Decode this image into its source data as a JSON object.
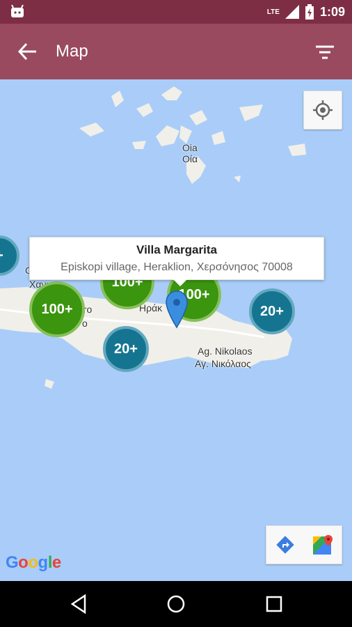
{
  "status": {
    "network": "LTE",
    "time": "1:09"
  },
  "appbar": {
    "title": "Map"
  },
  "map": {
    "labels": {
      "oia1": "Oia",
      "oia2": "Οία",
      "heraklion": "Ηράκ",
      "ag_nikolaos_latin": "Ag. Nikolaos",
      "ag_nikolaos_greek": "Αγ. Νικόλαος",
      "hania": "Χανι",
      "o_label": "Ο",
      "ero": "ero",
      "o2": "o"
    },
    "clusters": [
      {
        "label": "+",
        "color": "teal"
      },
      {
        "label": "100+",
        "color": "green"
      },
      {
        "label": "100+",
        "color": "green"
      },
      {
        "label": "100+",
        "color": "green"
      },
      {
        "label": "20+",
        "color": "teal"
      },
      {
        "label": "20+",
        "color": "teal"
      }
    ],
    "info": {
      "title": "Villa Margarita",
      "address": "Episkopi village, Heraklion, Χερσόνησος 70008"
    },
    "attribution": "Google"
  },
  "colors": {
    "appbar": "#9a4a5f",
    "statusbar": "#7d2e44",
    "water": "#a9cdf8",
    "land": "#f1efe9"
  }
}
